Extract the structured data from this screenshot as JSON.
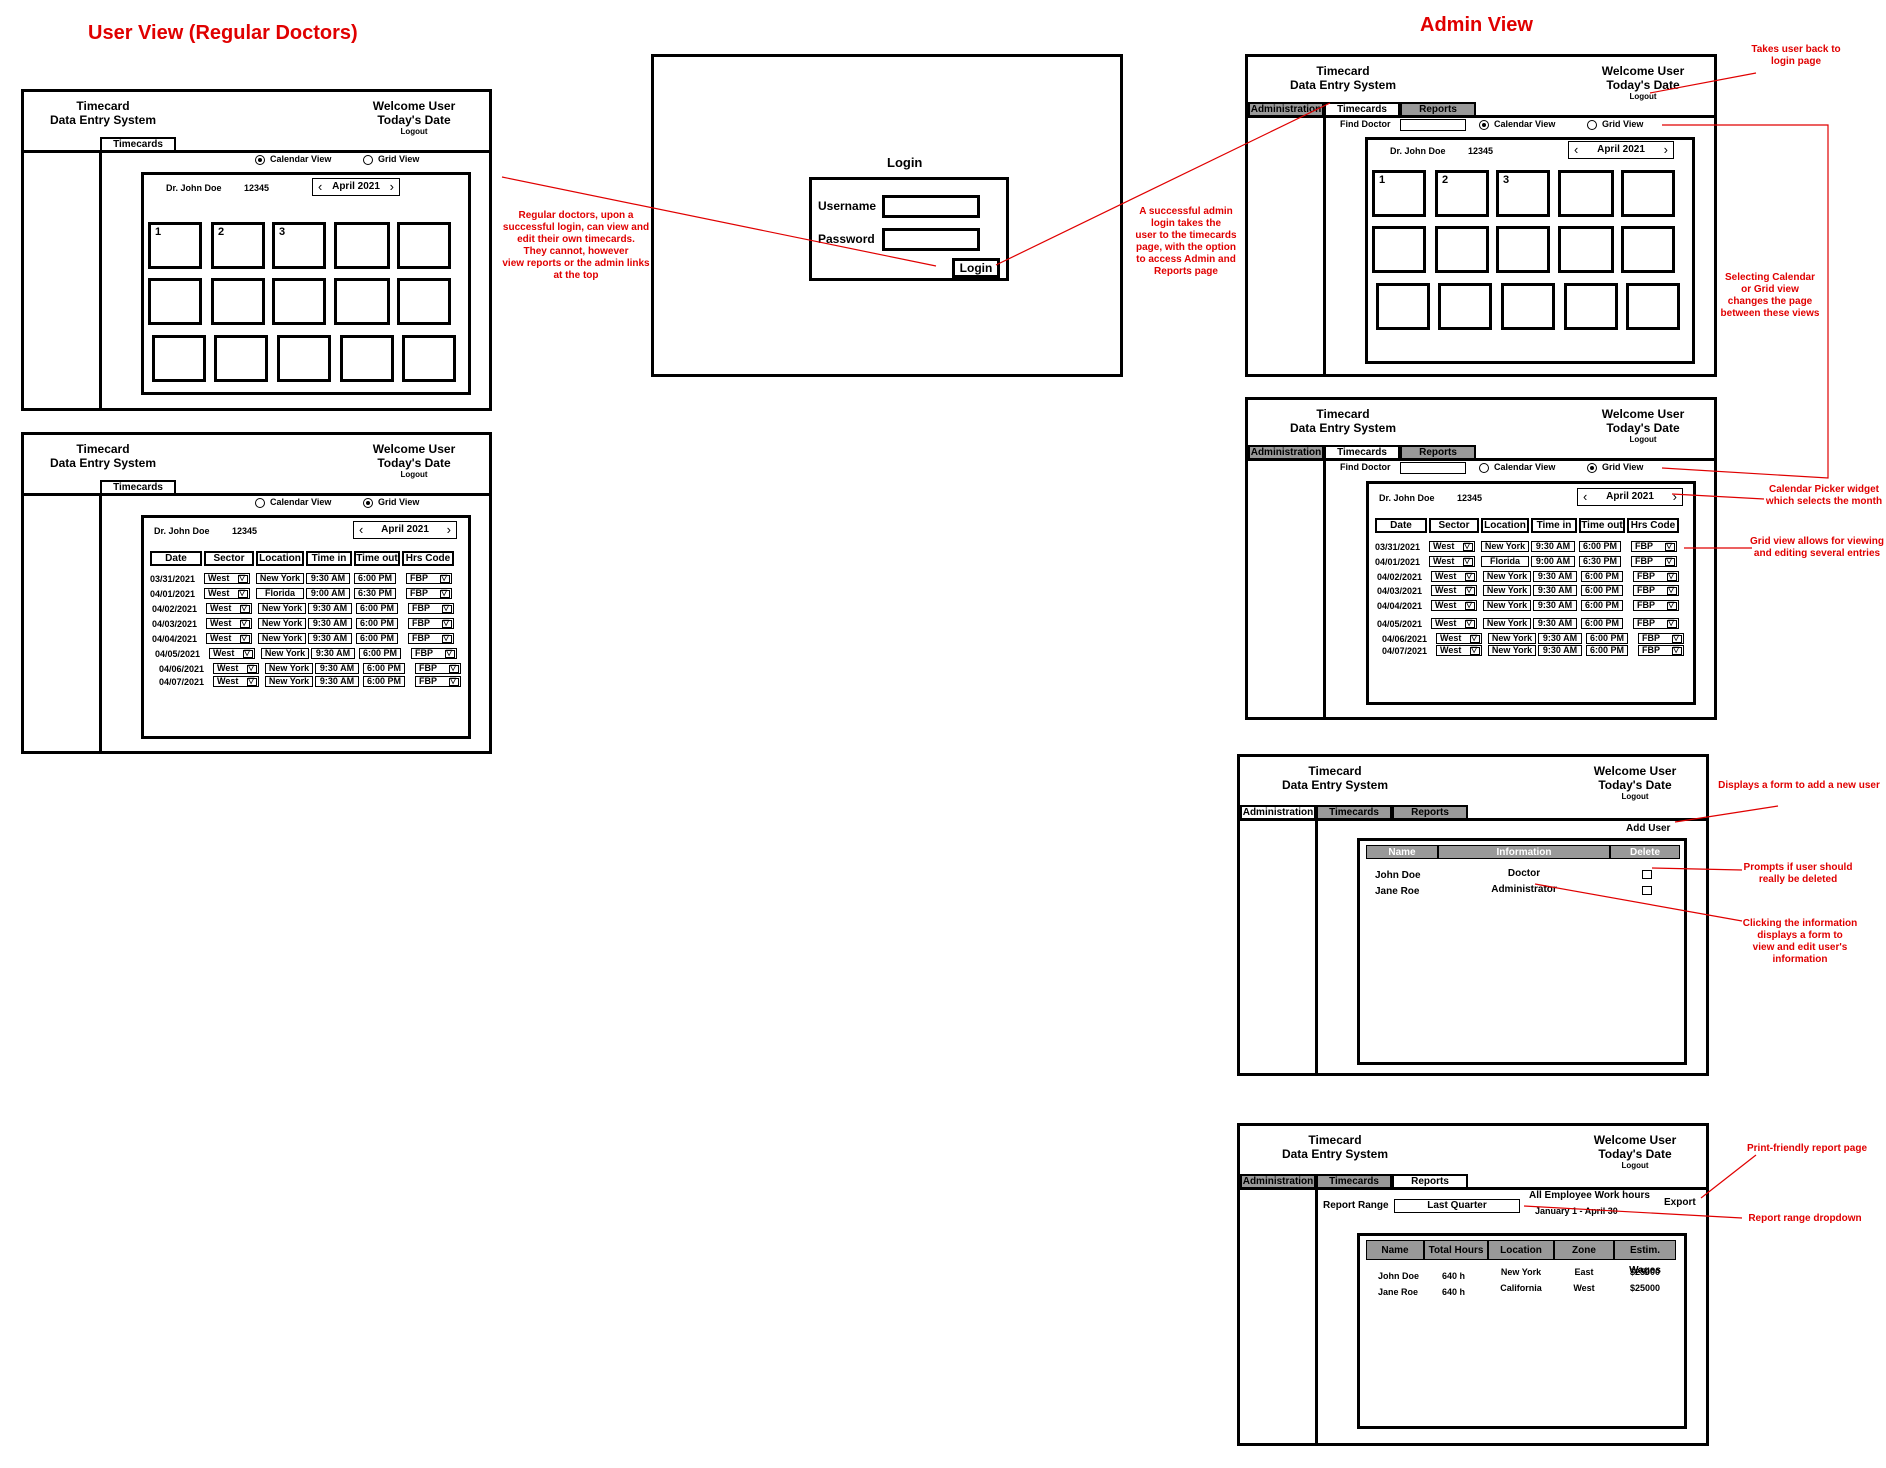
{
  "headings": {
    "user_view": "User View (Regular Doctors)",
    "admin_view": "Admin View"
  },
  "app": {
    "title_line1": "Timecard",
    "title_line2": "Data Entry System",
    "welcome": "Welcome User",
    "date": "Today's Date",
    "logout": "Logout"
  },
  "tabs": {
    "administration": "Administration",
    "timecards": "Timecards",
    "reports": "Reports"
  },
  "view_toggle": {
    "calendar": "Calendar View",
    "grid": "Grid View"
  },
  "find_doctor": "Find Doctor",
  "doctor": {
    "name": "Dr. John Doe",
    "id": "12345"
  },
  "month_picker": {
    "label": "April 2021",
    "prev": "‹",
    "next": "›"
  },
  "calendar_days": [
    "1",
    "2",
    "3"
  ],
  "grid": {
    "headers": [
      "Date",
      "Sector",
      "Location",
      "Time in",
      "Time out",
      "Hrs Code"
    ],
    "rows": [
      {
        "date": "03/31/2021",
        "sector": "West",
        "location": "New York",
        "time_in": "9:30 AM",
        "time_out": "6:00 PM",
        "code": "FBP"
      },
      {
        "date": "04/01/2021",
        "sector": "West",
        "location": "Florida",
        "time_in": "9:00 AM",
        "time_out": "6:30 PM",
        "code": "FBP"
      },
      {
        "date": "04/02/2021",
        "sector": "West",
        "location": "New York",
        "time_in": "9:30 AM",
        "time_out": "6:00 PM",
        "code": "FBP"
      },
      {
        "date": "04/03/2021",
        "sector": "West",
        "location": "New York",
        "time_in": "9:30 AM",
        "time_out": "6:00 PM",
        "code": "FBP"
      },
      {
        "date": "04/04/2021",
        "sector": "West",
        "location": "New York",
        "time_in": "9:30 AM",
        "time_out": "6:00 PM",
        "code": "FBP"
      },
      {
        "date": "04/05/2021",
        "sector": "West",
        "location": "New York",
        "time_in": "9:30 AM",
        "time_out": "6:00 PM",
        "code": "FBP"
      },
      {
        "date": "04/06/2021",
        "sector": "West",
        "location": "New York",
        "time_in": "9:30 AM",
        "time_out": "6:00 PM",
        "code": "FBP"
      },
      {
        "date": "04/07/2021",
        "sector": "West",
        "location": "New York",
        "time_in": "9:30 AM",
        "time_out": "6:00 PM",
        "code": "FBP"
      }
    ]
  },
  "login": {
    "title": "Login",
    "username_label": "Username",
    "password_label": "Password",
    "button": "Login"
  },
  "admin_users": {
    "add_user": "Add User",
    "headers": [
      "Name",
      "Information",
      "Delete"
    ],
    "rows": [
      {
        "name": "John Doe",
        "info": "Doctor"
      },
      {
        "name": "Jane Roe",
        "info": "Administrator"
      }
    ]
  },
  "reports": {
    "range_label": "Report Range",
    "range_value": "Last Quarter",
    "title": "All Employee Work hours",
    "subtitle": "January 1 - April 30",
    "export": "Export",
    "headers": [
      "Name",
      "Total Hours",
      "Location",
      "Zone",
      "Estim. Wages"
    ],
    "rows": [
      {
        "name": "John Doe",
        "hours": "640 h",
        "location": "New York",
        "zone": "East",
        "wages": "$25000"
      },
      {
        "name": "Jane Roe",
        "hours": "640 h",
        "location": "California",
        "zone": "West",
        "wages": "$25000"
      }
    ]
  },
  "notes": {
    "regular_doctors": [
      "Regular doctors, upon a",
      "successful login, can view and",
      "edit their own timecards.",
      "They cannot, however",
      "view reports or the admin links",
      "at the top"
    ],
    "admin_login": [
      "A successful admin",
      "login takes the",
      "user to the timecards",
      "page, with the option",
      "to access Admin and",
      "Reports page"
    ],
    "logout": [
      "Takes user back to",
      "login page"
    ],
    "toggle": [
      "Selecting Calendar",
      "or Grid view",
      "changes the page",
      "between these views"
    ],
    "picker": [
      "Calendar Picker widget",
      "which selects the month"
    ],
    "grid": [
      "Grid view allows for viewing",
      "and editing several entries"
    ],
    "add_user": [
      "Displays a form to add a new user"
    ],
    "delete": [
      "Prompts if user should",
      "really be deleted"
    ],
    "info": [
      "Clicking the information",
      "displays a form to",
      "view and edit user's",
      "information"
    ],
    "print": [
      "Print-friendly report page"
    ],
    "range": [
      "Report range dropdown"
    ]
  },
  "colors": {
    "annotation": "#e00000",
    "tab_inactive": "#999999",
    "table_header": "#999999"
  }
}
